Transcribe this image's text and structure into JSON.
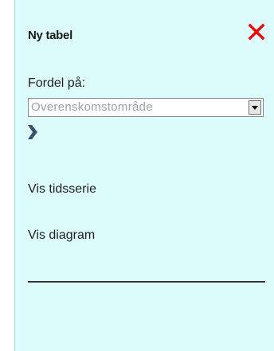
{
  "panel": {
    "title": "Ny tabel",
    "close_icon": "close-icon",
    "accent_color": "#ff0000",
    "background_color": "#dcfcfc"
  },
  "distribute": {
    "label": "Fordel på:",
    "select_value": "Overenskomstområde"
  },
  "links": {
    "time_series": "Vis tidsserie",
    "diagram": "Vis diagram"
  }
}
